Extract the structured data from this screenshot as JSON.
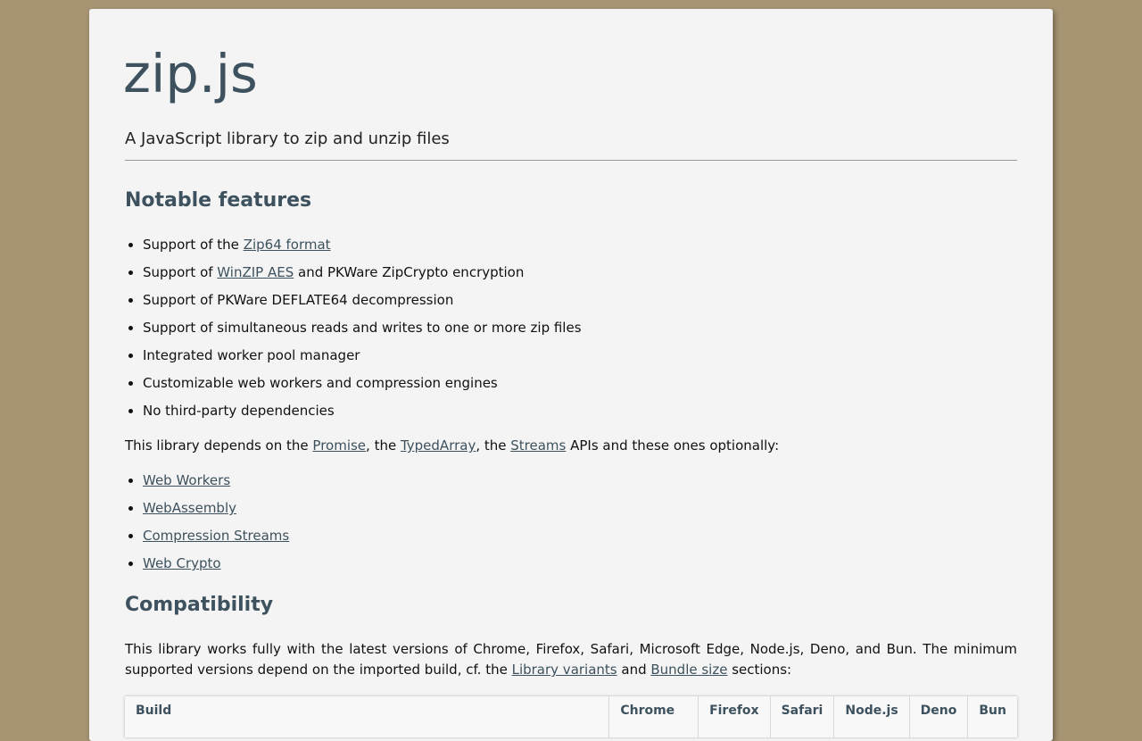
{
  "header": {
    "title": "zip.js",
    "tagline": "A JavaScript library to zip and unzip files"
  },
  "features": {
    "heading": "Notable features",
    "items": [
      {
        "prefix": "Support of the ",
        "link": "Zip64 format",
        "suffix": ""
      },
      {
        "prefix": "Support of ",
        "link": "WinZIP AES",
        "suffix": " and PKWare ZipCrypto encryption"
      },
      {
        "text": "Support of PKWare DEFLATE64 decompression"
      },
      {
        "text": "Support of simultaneous reads and writes to one or more zip files"
      },
      {
        "text": "Integrated worker pool manager"
      },
      {
        "text": "Customizable web workers and compression engines"
      },
      {
        "text": "No third-party dependencies"
      }
    ]
  },
  "depends": {
    "t1": "This library depends on the ",
    "link1": "Promise",
    "t2": ", the ",
    "link2": "TypedArray",
    "t3": ", the ",
    "link3": "Streams",
    "t4": " APIs and these ones optionally:"
  },
  "apis": [
    "Web Workers",
    "WebAssembly",
    "Compression Streams",
    "Web Crypto"
  ],
  "compatibility": {
    "heading": "Compatibility",
    "t1": "This library works fully with the latest versions of Chrome, Firefox, Safari, Microsoft Edge, Node.js, Deno, and Bun. The minimum supported versions depend on the imported build, cf. the ",
    "link1": "Library variants",
    "t2": " and ",
    "link2": "Bundle size",
    "t3": " sections:"
  },
  "table": {
    "headers": [
      "Build",
      "Chrome",
      "Firefox",
      "Safari",
      "Node.js",
      "Deno",
      "Bun"
    ]
  }
}
